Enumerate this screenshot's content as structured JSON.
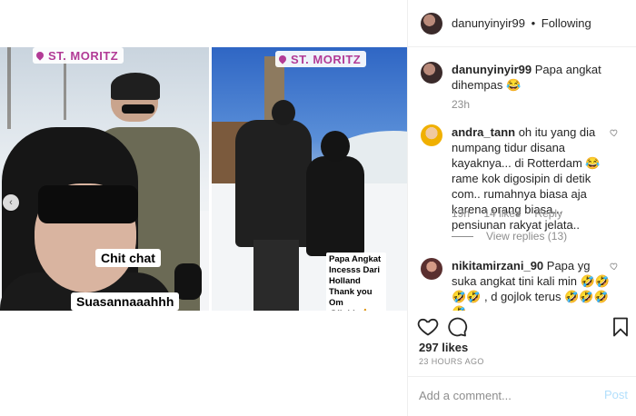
{
  "post": {
    "owner": "danunyinyir99",
    "follow_status": "Following",
    "dot": "•"
  },
  "media": {
    "location_left": "ST. MORITZ",
    "location_right": "ST. MORITZ",
    "caption_line1": "Chit chat",
    "caption_line2": "Suasannaaahhh",
    "story_note": "Papa Angkat\nIncesss Dari\nHolland\nThank you Om\n@liohk 🙏 Jagain\nIncesss Winter Holiday",
    "prev_arrow": "‹"
  },
  "comments": [
    {
      "username": "danunyinyir99",
      "text": "Papa angkat dihempas 😂",
      "time": "23h"
    },
    {
      "username": "andra_tann",
      "text": "oh itu yang dia numpang tidur disana kayaknya... di Rotterdam 😂 rame kok digosipin di detik com.. rumahnya biasa aja karena orang biasa... pensiunan rakyat jelata..",
      "time": "19h",
      "likes": "14 likes",
      "reply": "Reply",
      "view_replies": "View replies (13)"
    },
    {
      "username": "nikitamirzani_90",
      "text": "Papa yg suka angkat tini kali min 🤣🤣🤣🤣 , d gojlok terus 🤣🤣🤣🤣"
    }
  ],
  "footer": {
    "likes": "297 likes",
    "time": "23 HOURS AGO",
    "comment_placeholder": "Add a comment...",
    "post_label": "Post"
  },
  "colors": {
    "sticker": "#b23b96",
    "post_disabled": "#b2dffc",
    "meta_gray": "#8e8e8e"
  }
}
